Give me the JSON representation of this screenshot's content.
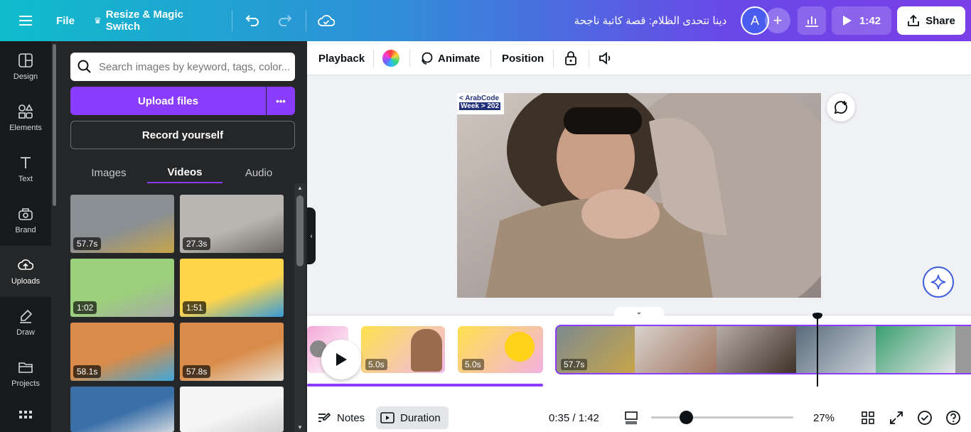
{
  "topbar": {
    "file_label": "File",
    "resize_label": "Resize & Magic Switch",
    "design_title": "دينا تتحدى الظلام: قصة كاتبة ناجحة",
    "avatar_letter": "A",
    "play_duration": "1:42",
    "share_label": "Share"
  },
  "rail": {
    "items": [
      {
        "label": "Design",
        "icon": "design-icon"
      },
      {
        "label": "Elements",
        "icon": "elements-icon"
      },
      {
        "label": "Text",
        "icon": "text-icon"
      },
      {
        "label": "Brand",
        "icon": "brand-icon"
      },
      {
        "label": "Uploads",
        "icon": "uploads-icon"
      },
      {
        "label": "Draw",
        "icon": "draw-icon"
      },
      {
        "label": "Projects",
        "icon": "projects-icon"
      }
    ]
  },
  "panel": {
    "search_placeholder": "Search images by keyword, tags, color...",
    "upload_label": "Upload files",
    "more_label": "•••",
    "record_label": "Record yourself",
    "tabs": [
      "Images",
      "Videos",
      "Audio"
    ],
    "active_tab": "Videos",
    "videos": [
      {
        "duration": "57.7s",
        "colors": [
          "#8a8f94",
          "#c7a54a"
        ]
      },
      {
        "duration": "27.3s",
        "colors": [
          "#b9b6b1",
          "#6d6a66"
        ]
      },
      {
        "duration": "1:02",
        "colors": [
          "#9bd17a",
          "#a9a9a9"
        ]
      },
      {
        "duration": "1:51",
        "colors": [
          "#ffd54a",
          "#3a9bd8"
        ]
      },
      {
        "duration": "58.1s",
        "colors": [
          "#d98c4a",
          "#3fa7d9"
        ]
      },
      {
        "duration": "57.8s",
        "colors": [
          "#d98c4a",
          "#e8e2d6"
        ]
      },
      {
        "duration": "",
        "colors": [
          "#3a6fa8",
          "#cfd7df"
        ]
      },
      {
        "duration": "",
        "colors": [
          "#f5f5f5",
          "#d0d0d0"
        ]
      }
    ]
  },
  "toolbar": {
    "playback": "Playback",
    "animate": "Animate",
    "position": "Position"
  },
  "canvas": {
    "logo_line1": "< ArabCode",
    "logo_line2": "Week > 202"
  },
  "timeline": {
    "clips": [
      {
        "duration": "",
        "colors": [
          "#f3a8d8",
          "#ffffff"
        ]
      },
      {
        "duration": "5.0s",
        "colors": [
          "#ffe14d",
          "#f0b8e8"
        ]
      },
      {
        "duration": "5.0s",
        "colors": [
          "#ffe14d",
          "#f3b1e0"
        ]
      },
      {
        "duration": "57.7s",
        "colors": [
          "#7d8a8f",
          "#6b4e8a"
        ]
      }
    ]
  },
  "bottom": {
    "notes_label": "Notes",
    "duration_label": "Duration",
    "time_readout": "0:35 / 1:42",
    "zoom_label": "27%"
  }
}
